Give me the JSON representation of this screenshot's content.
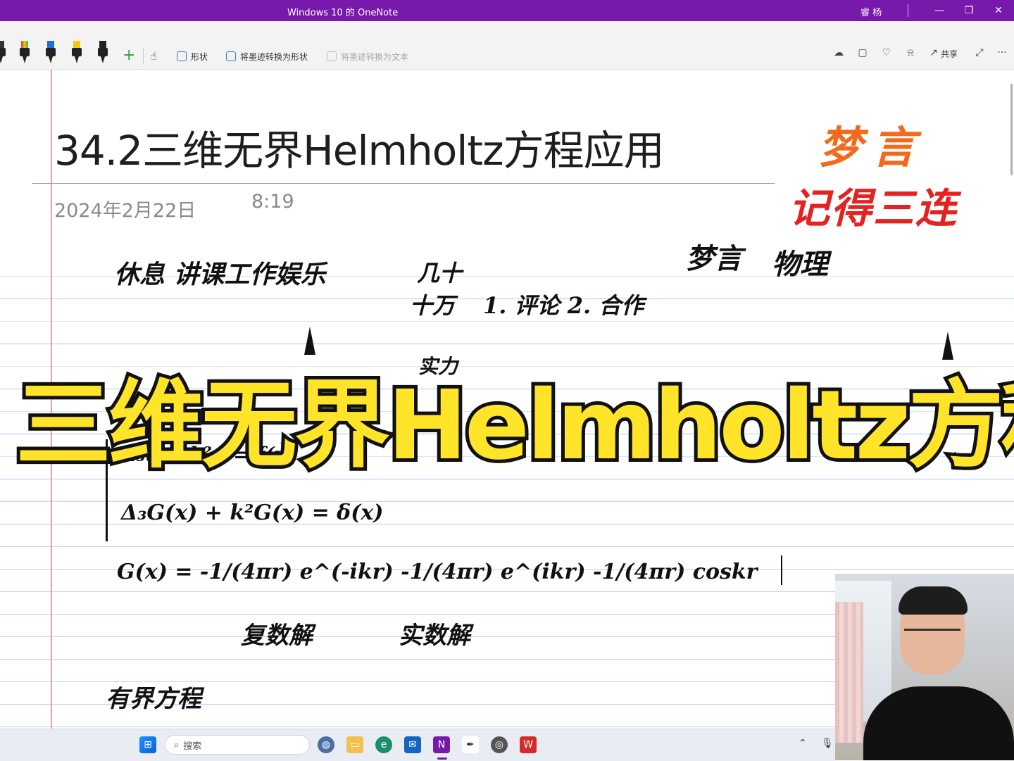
{
  "window": {
    "title": "Windows 10 的 OneNote",
    "user": "睿 杨",
    "minimize": "—",
    "restore": "❐",
    "close": "✕"
  },
  "ribbon": {
    "add": "+",
    "shapes_label": "形状",
    "ink_to_shape_label": "将墨迹转换为形状",
    "ink_to_text_label": "将墨迹转换为文本",
    "share_label": "共享",
    "more": "···",
    "pen_colors": [
      "#e23b2e",
      "#1e6fd9",
      "#f5c518",
      "#222222"
    ]
  },
  "page": {
    "title": "34.2三维无界Helmholtz方程应用",
    "date": "2024年2月22日",
    "time": "8:19"
  },
  "brand": {
    "line1": "梦言",
    "line2": "记得三连"
  },
  "handwriting": {
    "h1": "休息 讲课工作娱乐",
    "h2": "几十",
    "h3": "十万",
    "h4": "1. 评论 2. 合作",
    "h5": "梦言",
    "h6": "物理",
    "h7": "实力",
    "eq1": "Δ₃u + k²u = f(x)",
    "eq2": "Δ₃G(x) + k²G(x) = δ(x)",
    "eq3": "G(x) = -1/(4πr) e^(-ikr)   -1/(4πr) e^(ikr)   -1/(4πr) coskr",
    "note1": "复数解",
    "note2": "实数解",
    "note3": "有界方程"
  },
  "overlay": {
    "banner": "三维无界Helmholtz方程"
  },
  "taskbar": {
    "search_placeholder": "搜索",
    "start_icon": "windows-icon",
    "onenote_letter": "N"
  }
}
